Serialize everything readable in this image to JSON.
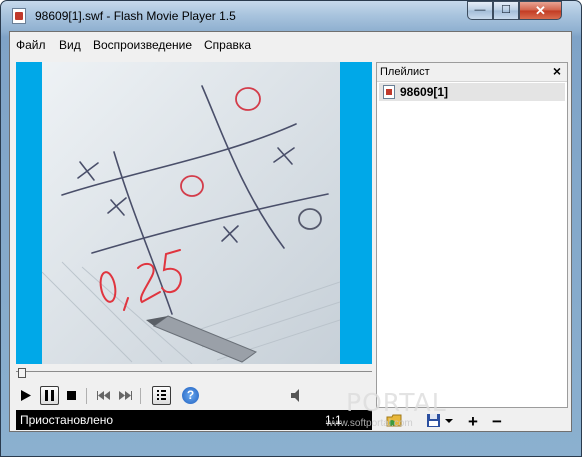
{
  "window": {
    "title": "98609[1].swf - Flash Movie Player 1.5",
    "min_glyph": "—",
    "max_glyph": "☐",
    "close_glyph": "✕"
  },
  "menu": {
    "items": [
      "Файл",
      "Вид",
      "Воспроизведение",
      "Справка"
    ]
  },
  "video": {
    "content": "hand-drawn tic-tac-toe on paper",
    "handwritten_number": "0,25"
  },
  "controls": {
    "state": "paused",
    "help_glyph": "?"
  },
  "status": {
    "text": "Приостановлено",
    "ratio": "1:1"
  },
  "playlist": {
    "title": "Плейлист",
    "close_glyph": "×",
    "items": [
      "98609[1]"
    ],
    "add_glyph": "+",
    "remove_glyph": "−"
  },
  "watermark": {
    "text": "PORTAL",
    "url": "www.softportal.com"
  },
  "colors": {
    "video_background": "#00a8e8",
    "status_background": "#000000",
    "title_gradient_top": "#c6d9ec"
  }
}
